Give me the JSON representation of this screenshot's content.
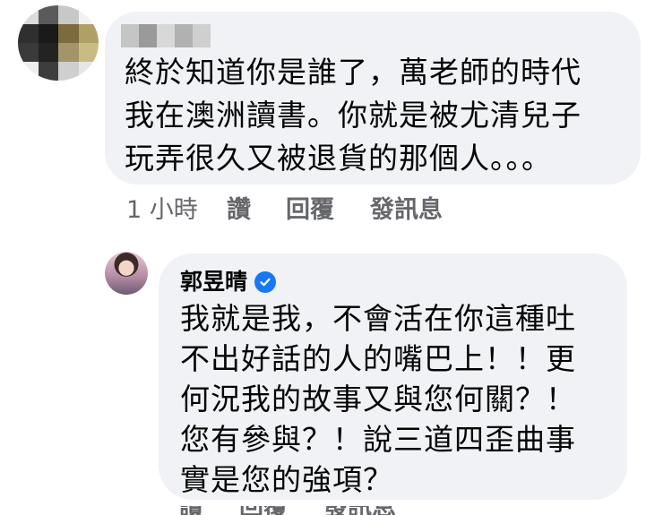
{
  "top_comment": {
    "author_pixels": [
      "#c5c5c5",
      "#9a9a9a",
      "#d8d8d8",
      "#b1b1b1",
      "#cfcfcf"
    ],
    "avatar_pixels": [
      "#dcdcdc",
      "#5a5a5a",
      "#c8c8c8",
      "#f2f2f2",
      "#2f2f2f",
      "#1a1a1a",
      "#7b6b3d",
      "#b0a068",
      "#3a3a3a",
      "#232323",
      "#a3956a",
      "#c9bc83",
      "#eeeeee",
      "#3d3d3d",
      "#cfcfcf",
      "#e6e6e6"
    ],
    "text": "終於知道你是誰了，萬老師的時代\n我在澳洲讀書。你就是被尤清兒子\n玩弄很久又被退貨的那個人。。。",
    "actions": {
      "time": "1 小時",
      "like": "讚",
      "reply": "回覆",
      "message": "發訊息"
    }
  },
  "reply_comment": {
    "author": "郭昱晴",
    "verified_icon": "verified-check-icon",
    "text": "我就是我，不會活在你這種吐\n不出好話的人的嘴巴上！！更\n何況我的故事又與您何關？！\n您有參與？！說三道四歪曲事\n實是您的強項？",
    "actions": {
      "like": "讚",
      "reply": "回覆",
      "message": "發訊息"
    }
  },
  "colors": {
    "bubble": "#f0f2f5",
    "meta_text": "#65676b",
    "verified": "#1877f2",
    "text": "#050505"
  }
}
